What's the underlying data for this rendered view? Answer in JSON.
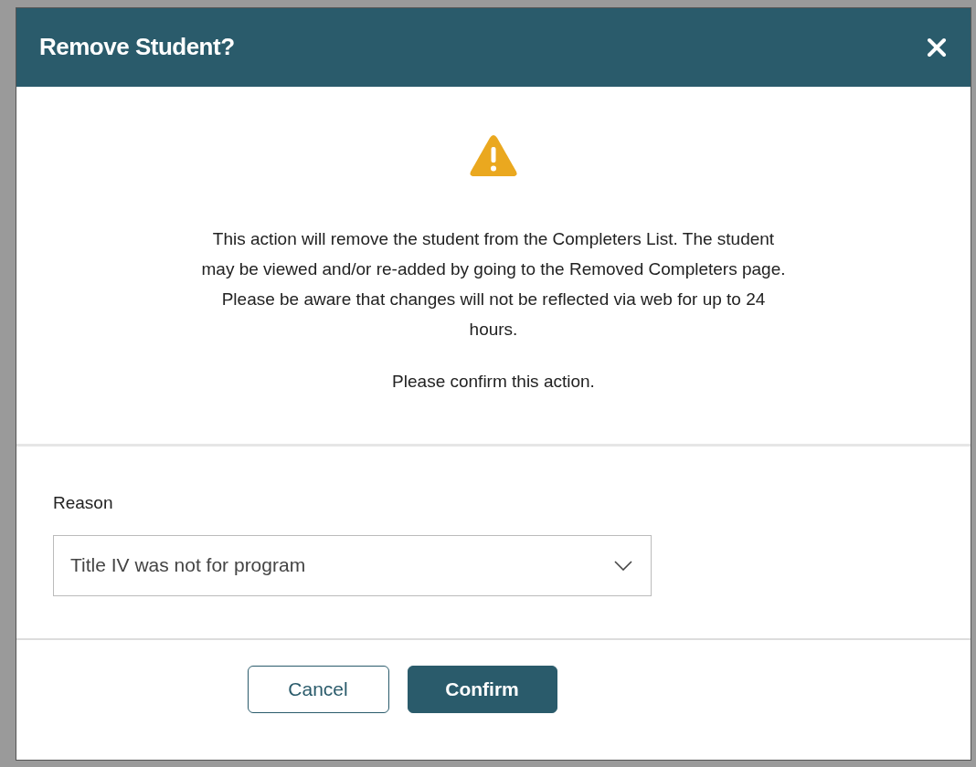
{
  "dialog": {
    "title": "Remove Student?",
    "message": "This action will remove the student from the Completers List. The student may be viewed and/or re-added by going to the Removed Completers page. Please be aware that changes will not be reflected via web for up to 24 hours.",
    "confirm_prompt": "Please confirm this action.",
    "reason": {
      "label": "Reason",
      "value": "Title IV was not for program"
    },
    "buttons": [
      {
        "label": "Cancel",
        "kind": "secondary"
      },
      {
        "label": "Confirm",
        "kind": "primary"
      }
    ]
  }
}
